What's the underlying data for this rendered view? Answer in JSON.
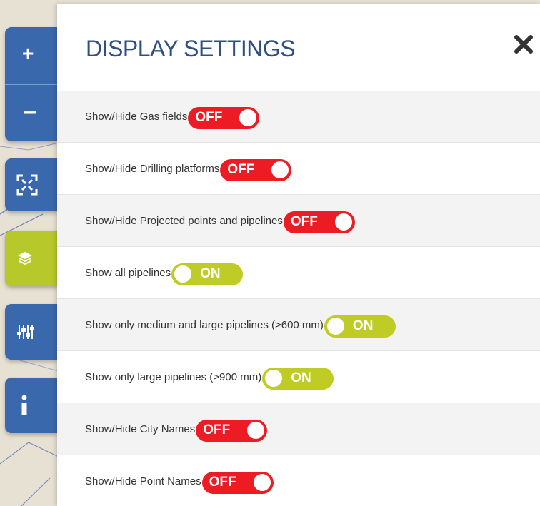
{
  "panel": {
    "title": "DISPLAY SETTINGS"
  },
  "map_controls": [
    {
      "name": "zoom-in",
      "icon": "plus-icon"
    },
    {
      "name": "zoom-out",
      "icon": "minus-icon"
    },
    {
      "name": "fullscreen",
      "icon": "fullscreen-icon"
    },
    {
      "name": "layers",
      "icon": "layers-icon",
      "active": true
    },
    {
      "name": "filters",
      "icon": "sliders-icon"
    },
    {
      "name": "info",
      "icon": "info-icon"
    }
  ],
  "settings": [
    {
      "label": "Show/Hide Gas fields",
      "state": "OFF"
    },
    {
      "label": "Show/Hide Drilling platforms",
      "state": "OFF"
    },
    {
      "label": "Show/Hide Projected points and pipelines",
      "state": "OFF"
    },
    {
      "label": "Show all pipelines",
      "state": "ON"
    },
    {
      "label": "Show only medium and large pipelines (>600 mm)",
      "state": "ON"
    },
    {
      "label": "Show only large pipelines (>900 mm)",
      "state": "ON"
    },
    {
      "label": "Show/Hide City Names",
      "state": "OFF"
    },
    {
      "label": "Show/Hide Point Names",
      "state": "OFF"
    }
  ],
  "colors": {
    "accent_blue": "#3a68ad",
    "active_green": "#b7c82a",
    "toggle_off": "#ed1b23",
    "toggle_on": "#bfcc25",
    "title": "#2f4e86"
  }
}
